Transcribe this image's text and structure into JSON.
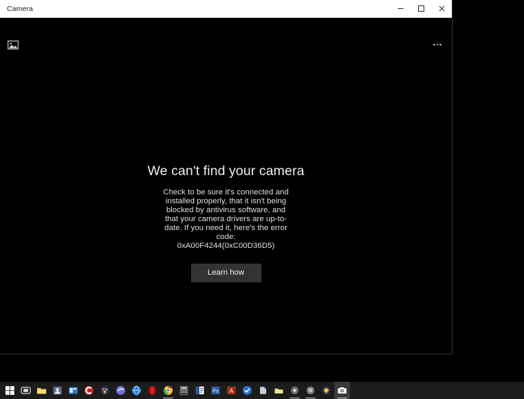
{
  "window": {
    "title": "Camera",
    "controls": [
      {
        "name": "minimize-button",
        "glyph": "minimize"
      },
      {
        "name": "maximize-button",
        "glyph": "maximize"
      },
      {
        "name": "close-button",
        "glyph": "close"
      }
    ]
  },
  "app": {
    "gallery_icon": "photo-gallery-icon",
    "overflow_icon": "more-options-icon",
    "error": {
      "heading": "We can't find your camera",
      "body": "Check to be sure it's connected and installed properly, that it isn't being blocked by antivirus software, and that your camera drivers are up-to-date. If you need it, here's the error code:",
      "code": "0xA00F4244(0xC00D36D5)",
      "button_label": "Learn how"
    }
  },
  "taskbar": {
    "items": [
      {
        "name": "start-button",
        "icon": "windows-logo-icon",
        "active": false,
        "running": false,
        "color": "#ffffff"
      },
      {
        "name": "task-view-button",
        "icon": "task-view-icon",
        "active": false,
        "running": false,
        "color": "#e8e8e8"
      },
      {
        "name": "file-explorer-button",
        "icon": "folder-icon",
        "active": false,
        "running": false,
        "color": "#f2c14e"
      },
      {
        "name": "app-button-1",
        "icon": "app-icon",
        "active": false,
        "running": false,
        "color": "#5a6b86"
      },
      {
        "name": "app-button-2",
        "icon": "app-icon",
        "active": false,
        "running": false,
        "color": "#2a7ac0"
      },
      {
        "name": "ccleaner-button",
        "icon": "ccleaner-icon",
        "active": false,
        "running": false,
        "color": "#c3261f"
      },
      {
        "name": "app-button-3",
        "icon": "app-icon",
        "active": false,
        "running": false,
        "color": "#b0447a"
      },
      {
        "name": "edge-button",
        "icon": "edge-icon",
        "active": false,
        "running": false,
        "color": "#5a5ad6"
      },
      {
        "name": "browser-button-1",
        "icon": "globe-icon",
        "active": false,
        "running": false,
        "color": "#2f7fd0"
      },
      {
        "name": "opera-button",
        "icon": "opera-icon",
        "active": false,
        "running": false,
        "color": "#cc1a1a"
      },
      {
        "name": "chrome-button",
        "icon": "chrome-icon",
        "active": false,
        "running": true,
        "color": "#4fae52"
      },
      {
        "name": "calculator-button",
        "icon": "calculator-icon",
        "active": false,
        "running": false,
        "color": "#8a8a8a"
      },
      {
        "name": "word-button",
        "icon": "word-icon",
        "active": false,
        "running": false,
        "color": "#2b5797"
      },
      {
        "name": "powerpoint-button",
        "icon": "powerpoint-icon",
        "active": false,
        "running": false,
        "color": "#2f5c9e"
      },
      {
        "name": "access-button",
        "icon": "access-icon",
        "active": false,
        "running": false,
        "color": "#a33219"
      },
      {
        "name": "app-button-4",
        "icon": "checkmark-icon",
        "active": false,
        "running": false,
        "color": "#2a6fc9"
      },
      {
        "name": "app-button-5",
        "icon": "document-icon",
        "active": false,
        "running": false,
        "color": "#c8d2de"
      },
      {
        "name": "app-button-6",
        "icon": "folder-icon",
        "active": false,
        "running": false,
        "color": "#e0d46a"
      },
      {
        "name": "app-button-7",
        "icon": "app-icon",
        "active": false,
        "running": true,
        "color": "#8e8e8e"
      },
      {
        "name": "app-button-8",
        "icon": "app-icon",
        "active": false,
        "running": true,
        "color": "#9a9a9a"
      },
      {
        "name": "app-button-9",
        "icon": "app-icon",
        "active": false,
        "running": false,
        "color": "#3a7bd5"
      },
      {
        "name": "camera-button",
        "icon": "camera-icon",
        "active": true,
        "running": true,
        "color": "#ffffff"
      }
    ]
  }
}
